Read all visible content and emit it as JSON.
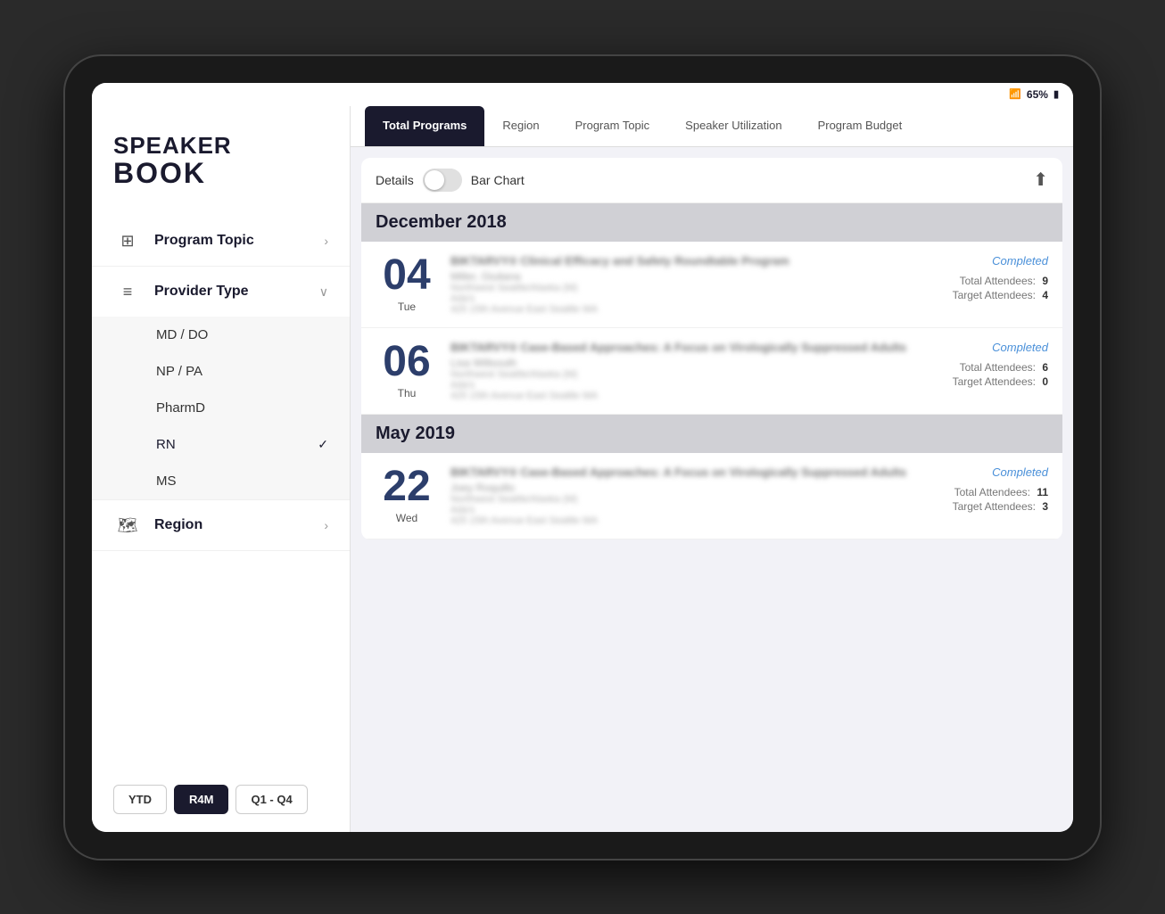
{
  "status_bar": {
    "wifi": "📶",
    "battery_pct": "65%",
    "battery_icon": "🔋"
  },
  "logo": {
    "speaker": "SPEAKER",
    "book": "BOOK"
  },
  "sidebar": {
    "nav_items": [
      {
        "id": "program-topic",
        "label": "Program Topic",
        "icon": "⊞",
        "chevron": "›",
        "expanded": false
      },
      {
        "id": "provider-type",
        "label": "Provider Type",
        "icon": "≡",
        "chevron": "∨",
        "expanded": true
      },
      {
        "id": "region",
        "label": "Region",
        "icon": "🗺",
        "chevron": "›",
        "expanded": false
      }
    ],
    "provider_options": [
      {
        "id": "md-do",
        "label": "MD / DO",
        "selected": false
      },
      {
        "id": "np-pa",
        "label": "NP / PA",
        "selected": false
      },
      {
        "id": "pharmd",
        "label": "PharmD",
        "selected": false
      },
      {
        "id": "rn",
        "label": "RN",
        "selected": true
      },
      {
        "id": "ms",
        "label": "MS",
        "selected": false
      }
    ],
    "period_buttons": [
      {
        "id": "ytd",
        "label": "YTD",
        "active": false
      },
      {
        "id": "r4m",
        "label": "R4M",
        "active": true
      },
      {
        "id": "q1-q4",
        "label": "Q1 - Q4",
        "active": false
      }
    ]
  },
  "tabs": [
    {
      "id": "total-programs",
      "label": "Total Programs",
      "active": true
    },
    {
      "id": "region",
      "label": "Region",
      "active": false
    },
    {
      "id": "program-topic",
      "label": "Program Topic",
      "active": false
    },
    {
      "id": "speaker-utilization",
      "label": "Speaker Utilization",
      "active": false
    },
    {
      "id": "program-budget",
      "label": "Program Budget",
      "active": false
    }
  ],
  "view_controls": {
    "details_label": "Details",
    "bar_chart_label": "Bar Chart",
    "share_icon": "⬆"
  },
  "months": [
    {
      "id": "dec-2018",
      "title": "December 2018",
      "programs": [
        {
          "id": "prog-dec-04",
          "date_number": "04",
          "date_day": "Tue",
          "title": "BIKTARVY® Clinical Efficacy and Safety Roundtable Program",
          "speaker": "Miller, Giuliana",
          "location": "Northwest Seattle/Alaska (M)",
          "venue": "Ada's",
          "address": "425 15th Avenue East Seattle WA",
          "status": "Completed",
          "total_attendees_label": "Total Attendees:",
          "total_attendees": "9",
          "target_attendees_label": "Target Attendees:",
          "target_attendees": "4"
        },
        {
          "id": "prog-dec-06",
          "date_number": "06",
          "date_day": "Thu",
          "title": "BIKTARVY® Case-Based Approaches: A Focus on Virologically Suppressed Adults",
          "speaker": "Lisa Willsouth",
          "location": "Northwest Seattle/Alaska (M)",
          "venue": "Ada's",
          "address": "425 15th Avenue East Seattle WA",
          "status": "Completed",
          "total_attendees_label": "Total Attendees:",
          "total_attendees": "6",
          "target_attendees_label": "Target Attendees:",
          "target_attendees": "0"
        }
      ]
    },
    {
      "id": "may-2019",
      "title": "May 2019",
      "programs": [
        {
          "id": "prog-may-22",
          "date_number": "22",
          "date_day": "Wed",
          "title": "BIKTARVY® Case-Based Approaches: A Focus on Virologically Suppressed Adults",
          "speaker": "Joey Roquillo",
          "location": "Northwest Seattle/Alaska (M)",
          "venue": "Ada's",
          "address": "425 15th Avenue East Seattle WA",
          "status": "Completed",
          "total_attendees_label": "Total Attendees:",
          "total_attendees": "11",
          "target_attendees_label": "Target Attendees:",
          "target_attendees": "3"
        }
      ]
    }
  ]
}
